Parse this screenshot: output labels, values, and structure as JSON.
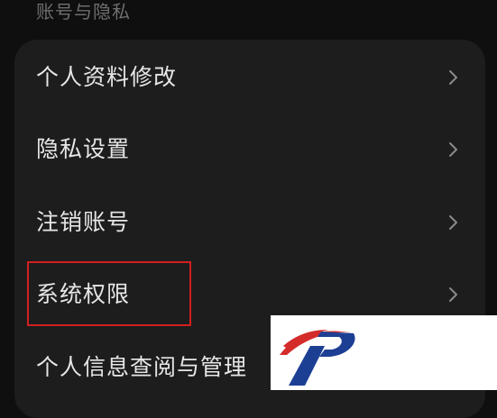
{
  "section": {
    "title": "账号与隐私"
  },
  "settings": {
    "items": [
      {
        "label": "个人资料修改",
        "icon": "chevron-right-icon"
      },
      {
        "label": "隐私设置",
        "icon": "chevron-right-icon"
      },
      {
        "label": "注销账号",
        "icon": "chevron-right-icon"
      },
      {
        "label": "系统权限",
        "icon": "chevron-right-icon"
      },
      {
        "label": "个人信息查阅与管理",
        "icon": "chevron-right-icon"
      }
    ]
  },
  "annotation": {
    "highlight_color": "#d21f1f"
  },
  "watermark": {
    "colors": [
      "#d42b2b",
      "#1c3f94"
    ]
  }
}
